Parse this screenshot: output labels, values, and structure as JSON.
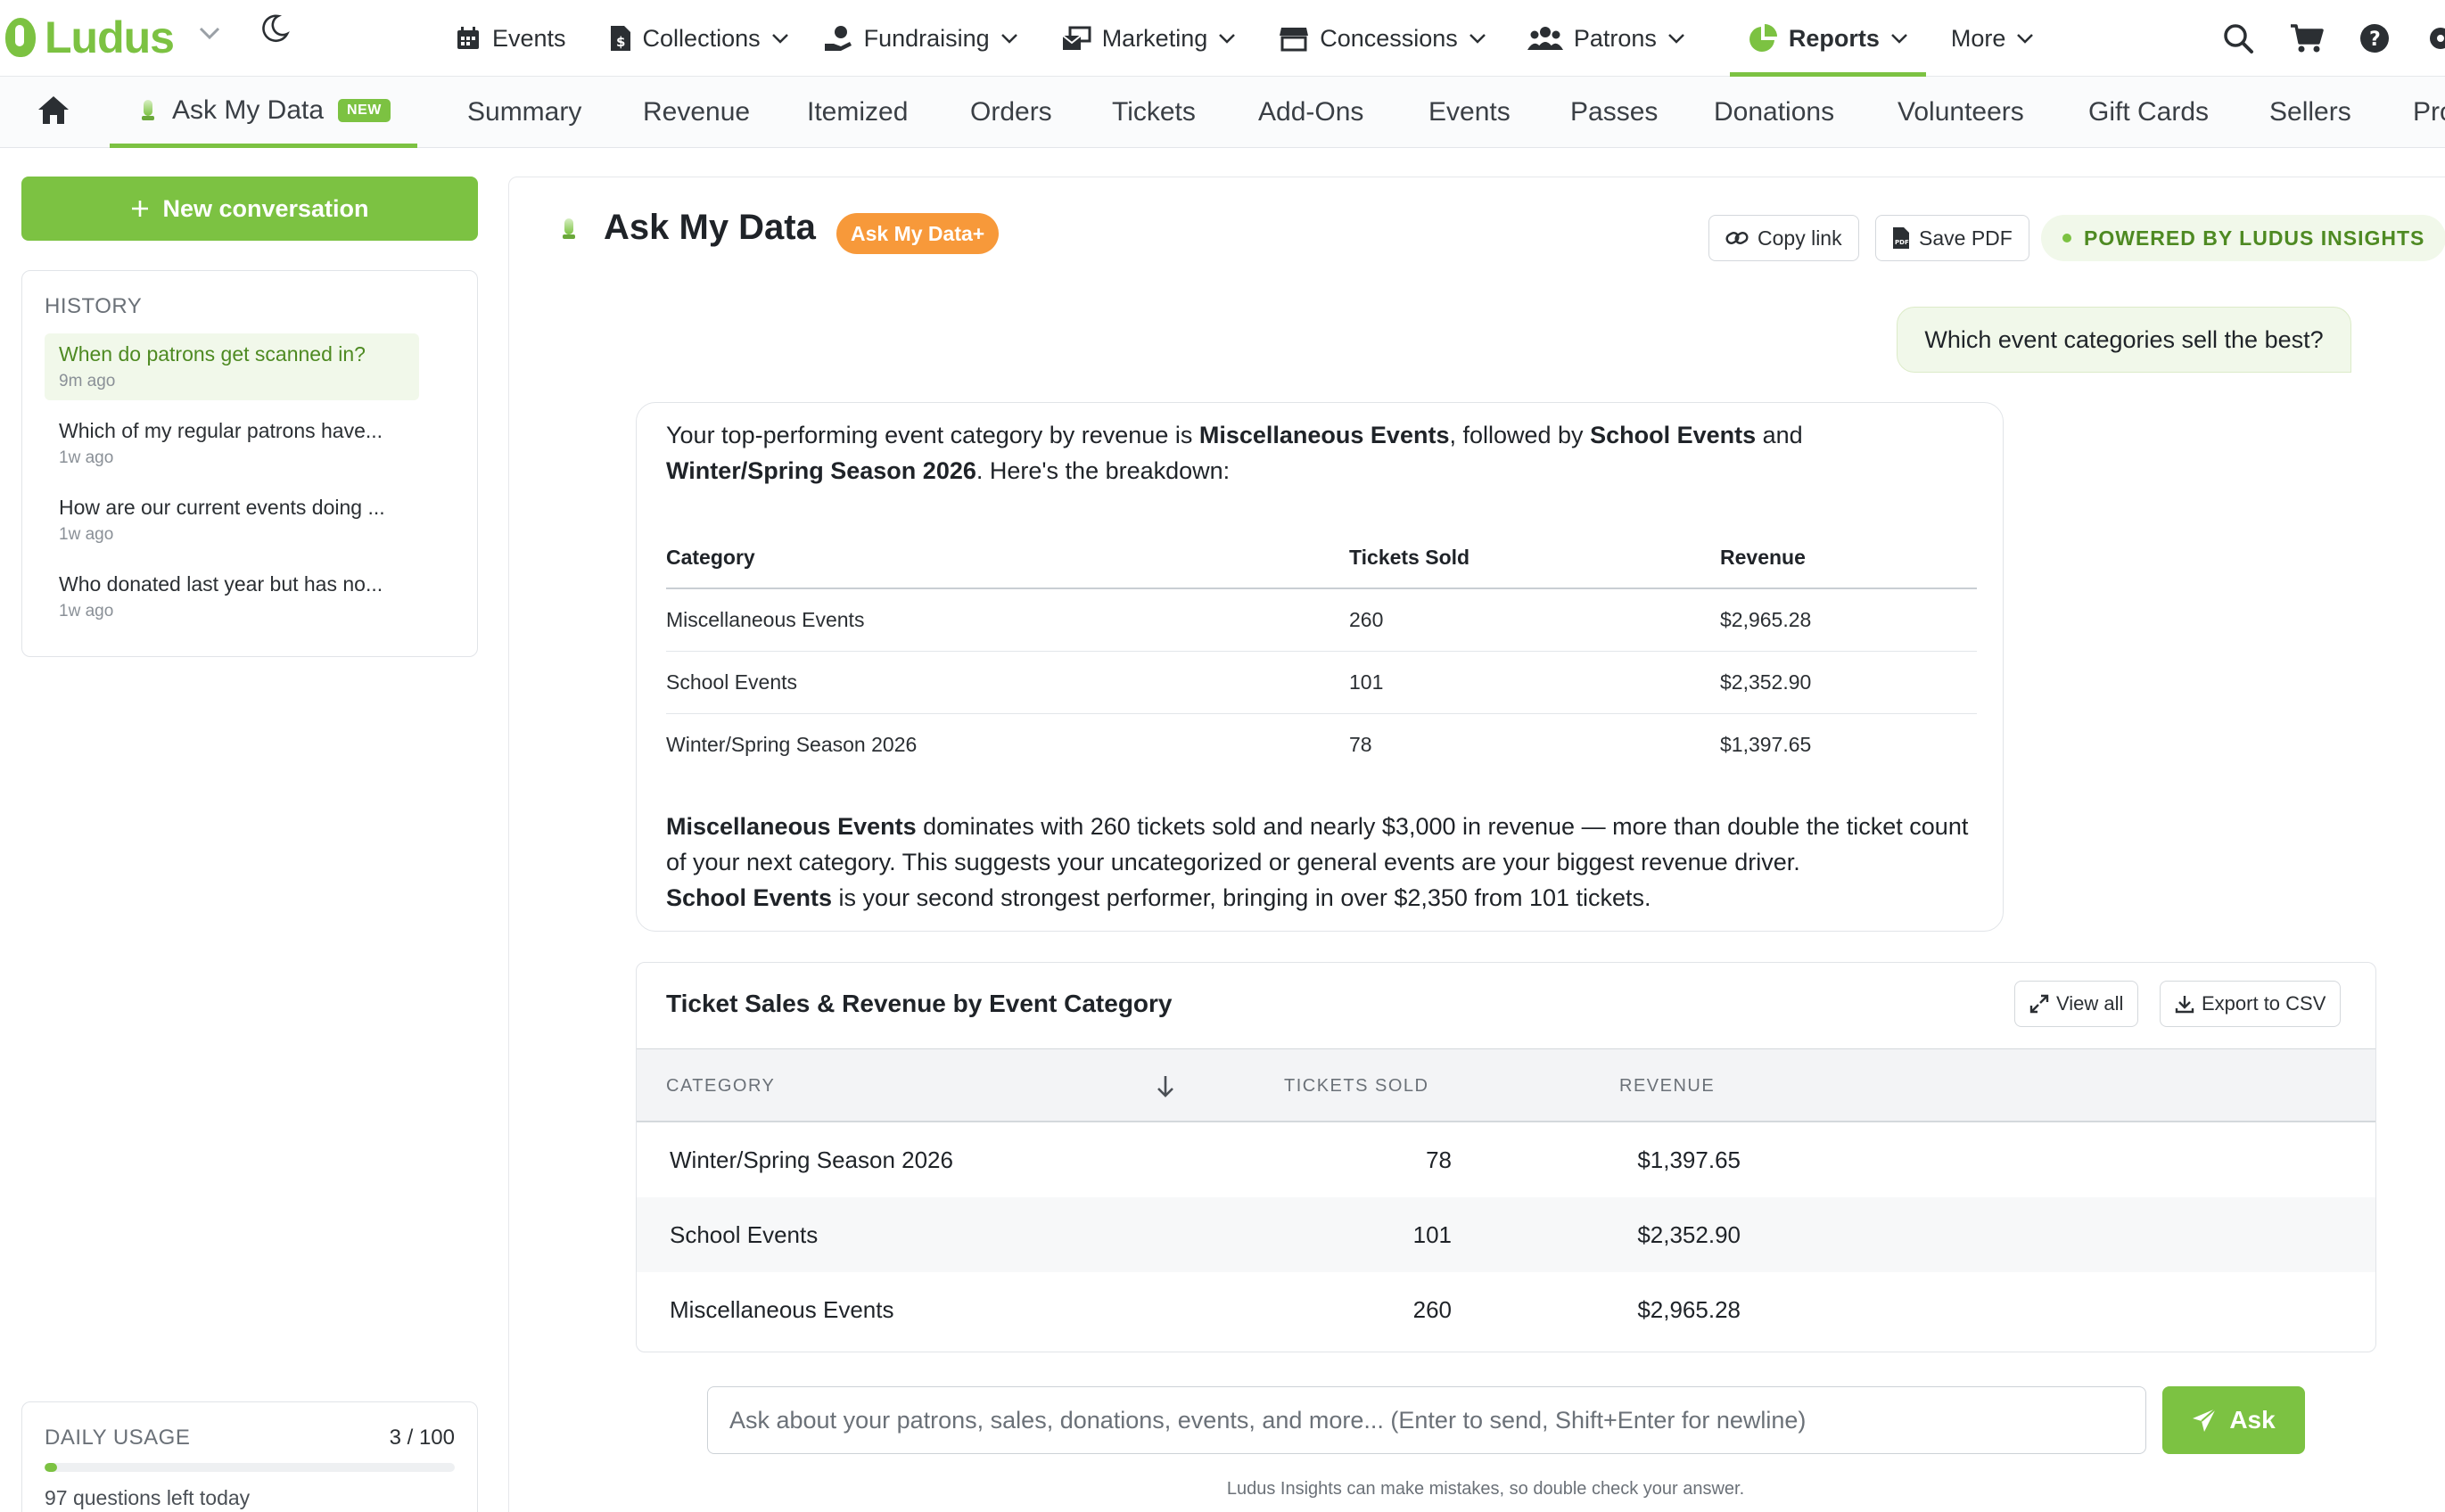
{
  "brand": {
    "name": "Ludus",
    "accent": "#7cc242",
    "orange": "#f7993a"
  },
  "topnav": {
    "items": [
      {
        "label": "Events",
        "icon": "calendar-icon",
        "caret": false
      },
      {
        "label": "Collections",
        "icon": "dollar-doc-icon",
        "caret": true
      },
      {
        "label": "Fundraising",
        "icon": "donate-hand-icon",
        "caret": true
      },
      {
        "label": "Marketing",
        "icon": "mail-bulk-icon",
        "caret": true
      },
      {
        "label": "Concessions",
        "icon": "store-icon",
        "caret": true
      },
      {
        "label": "Patrons",
        "icon": "users-icon",
        "caret": true
      },
      {
        "label": "Reports",
        "icon": "pie-chart-icon",
        "caret": true,
        "active": true
      },
      {
        "label": "More",
        "icon": "",
        "caret": true
      }
    ],
    "right_icons": [
      "search-icon",
      "cart-icon",
      "help-icon",
      "gear-icon"
    ]
  },
  "subnav": {
    "tabs": [
      "Ask My Data",
      "Summary",
      "Revenue",
      "Itemized",
      "Orders",
      "Tickets",
      "Add-Ons",
      "Events",
      "Passes",
      "Donations",
      "Volunteers",
      "Gift Cards",
      "Sellers",
      "Pro"
    ],
    "new_badge": "NEW"
  },
  "sidebar": {
    "new_conversation": "New conversation",
    "history_title": "HISTORY",
    "history": [
      {
        "question": "When do patrons get scanned in?",
        "time": "9m ago"
      },
      {
        "question": "Which of my regular patrons have...",
        "time": "1w ago"
      },
      {
        "question": "How are our current events doing ...",
        "time": "1w ago"
      },
      {
        "question": "Who donated last year but has no...",
        "time": "1w ago"
      }
    ],
    "usage": {
      "title": "DAILY USAGE",
      "count": "3 / 100",
      "fraction": 0.03,
      "left": "97 questions left today"
    }
  },
  "main": {
    "title": "Ask My Data",
    "plus_badge": "Ask My Data+",
    "copy_link": "Copy link",
    "save_pdf": "Save PDF",
    "powered": "POWERED BY LUDUS INSIGHTS",
    "user_question": "Which event categories sell the best?",
    "answer": {
      "intro_1": "Your top-performing event category by revenue is ",
      "intro_b1": "Miscellaneous Events",
      "intro_2": ", followed by ",
      "intro_b2": "School Events",
      "intro_3": " and ",
      "intro_b3": "Winter/Spring Season 2026",
      "intro_4": ". Here's the breakdown:",
      "table_headers": [
        "Category",
        "Tickets Sold",
        "Revenue"
      ],
      "table_rows": [
        [
          "Miscellaneous Events",
          "260",
          "$2,965.28"
        ],
        [
          "School Events",
          "101",
          "$2,352.90"
        ],
        [
          "Winter/Spring Season 2026",
          "78",
          "$1,397.65"
        ]
      ],
      "outro_b1": "Miscellaneous Events",
      "outro_1": " dominates with 260 tickets sold and nearly $3,000 in revenue — more than double the ticket count of your next category. This suggests your uncategorized or general events are your biggest revenue driver.",
      "outro_b2": "School Events",
      "outro_2": " is your second strongest performer, bringing in over $2,350 from 101 tickets."
    },
    "card": {
      "title": "Ticket Sales & Revenue by Event Category",
      "view_all": "View all",
      "export": "Export to CSV",
      "headers": [
        "CATEGORY",
        "TICKETS SOLD",
        "REVENUE"
      ],
      "rows": [
        [
          "Winter/Spring Season 2026",
          "78",
          "$1,397.65"
        ],
        [
          "School Events",
          "101",
          "$2,352.90"
        ],
        [
          "Miscellaneous Events",
          "260",
          "$2,965.28"
        ]
      ]
    },
    "input_placeholder": "Ask about your patrons, sales, donations, events, and more... (Enter to send, Shift+Enter for newline)",
    "ask_button": "Ask",
    "disclaimer": "Ludus Insights can make mistakes, so double check your answer."
  }
}
